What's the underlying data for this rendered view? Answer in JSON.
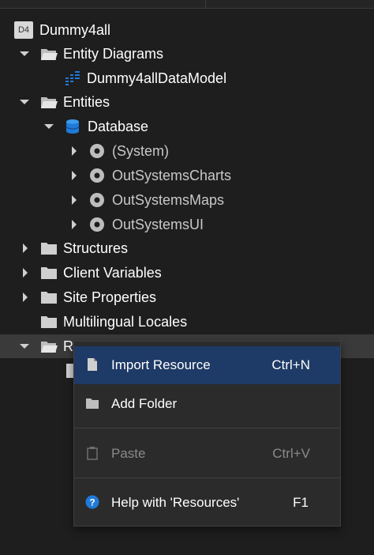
{
  "tree": {
    "root": {
      "badge": "D4",
      "label": "Dummy4all"
    },
    "entity_diagrams": {
      "label": "Entity Diagrams"
    },
    "data_model": {
      "label": "Dummy4allDataModel"
    },
    "entities": {
      "label": "Entities"
    },
    "database": {
      "label": "Database"
    },
    "modules": [
      {
        "label": "(System)"
      },
      {
        "label": "OutSystemsCharts"
      },
      {
        "label": "OutSystemsMaps"
      },
      {
        "label": "OutSystemsUI"
      }
    ],
    "structures": {
      "label": "Structures"
    },
    "client_variables": {
      "label": "Client Variables"
    },
    "site_properties": {
      "label": "Site Properties"
    },
    "multilingual_locales": {
      "label": "Multilingual Locales"
    },
    "resources": {
      "label": "R"
    }
  },
  "context_menu": {
    "import": {
      "label": "Import Resource",
      "shortcut": "Ctrl+N"
    },
    "add_folder": {
      "label": "Add Folder"
    },
    "paste": {
      "label": "Paste",
      "shortcut": "Ctrl+V"
    },
    "help": {
      "label": "Help with 'Resources'",
      "shortcut": "F1"
    }
  },
  "colors": {
    "accent": "#1e3a66",
    "icon_blue": "#1f7ad8"
  }
}
